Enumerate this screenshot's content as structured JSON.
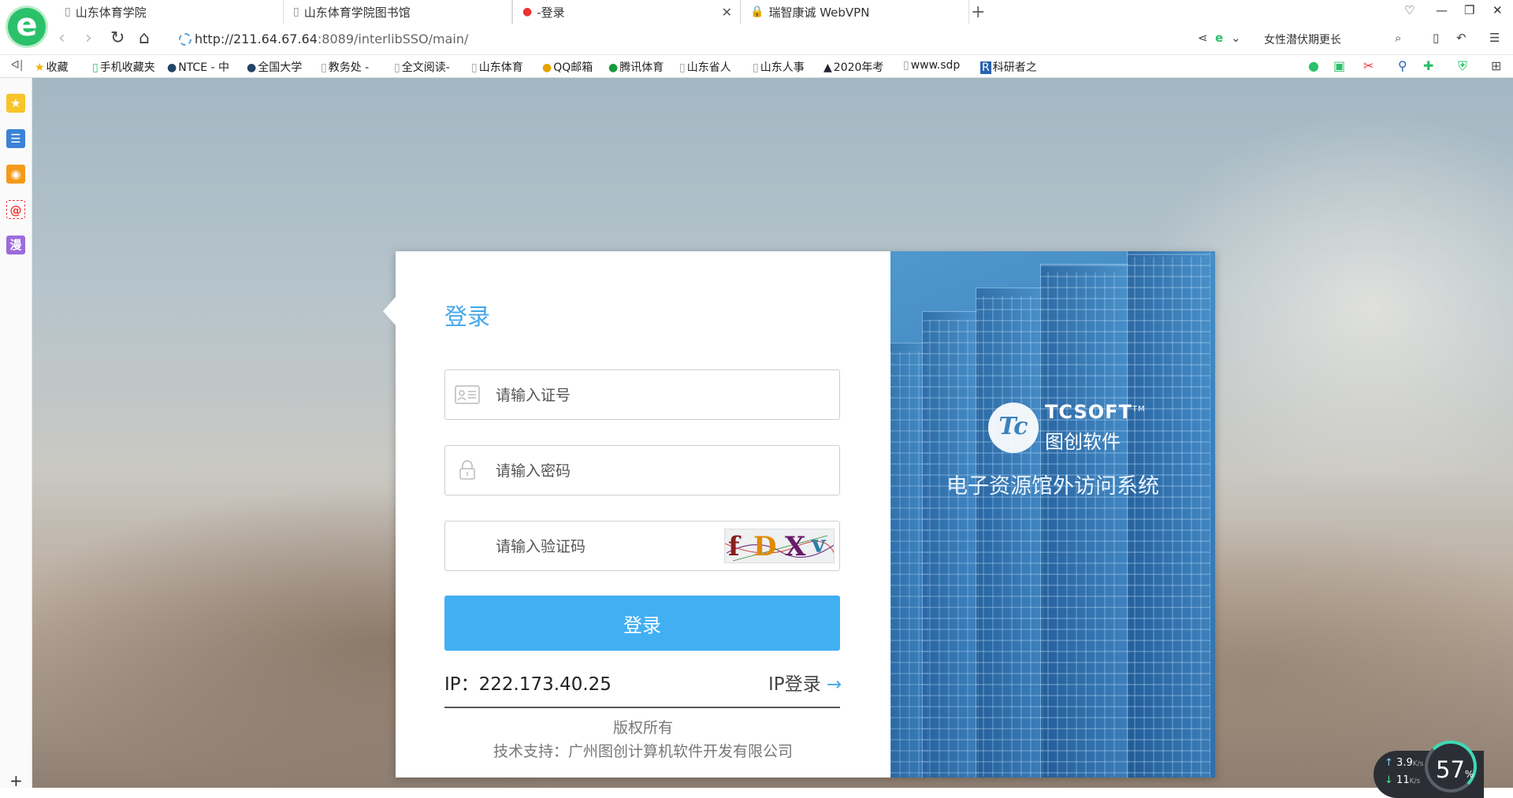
{
  "tabs": [
    {
      "label": "山东体育学院",
      "active": false
    },
    {
      "label": "山东体育学院图书馆",
      "active": false
    },
    {
      "label": "-登录",
      "active": true
    },
    {
      "label": "瑞智康诚 WebVPN",
      "active": false
    }
  ],
  "address": {
    "url_host": "http://211.64.67.64",
    "url_rest": ":8089/interlibSSO/main/"
  },
  "search": {
    "text": "女性潜伏期更长"
  },
  "bookmarks": [
    "收藏",
    "手机收藏夹",
    "NTCE - 中",
    "全国大学",
    "教务处 -",
    "全文阅读-",
    "山东体育",
    "QQ邮箱",
    "腾讯体育",
    "山东省人",
    "山东人事",
    "2020年考",
    "www.sdp",
    "科研者之"
  ],
  "sidebar": {
    "icons": [
      "star-icon",
      "list-icon",
      "weibo-icon",
      "mail-icon",
      "comic-icon"
    ],
    "comic_label": "漫"
  },
  "login": {
    "title": "登录",
    "id_placeholder": "请输入证号",
    "password_placeholder": "请输入密码",
    "captcha_placeholder": "请输入验证码",
    "captcha_text": [
      "f",
      "D",
      "X",
      "v"
    ],
    "button": "登录",
    "ip_label": "IP：222.173.40.25",
    "ip_login": "IP登录",
    "ip_login_arrow": "→",
    "copyright": "版权所有",
    "support": "技术支持：广州图创计算机软件开发有限公司"
  },
  "brand": {
    "logo_letters": "Tc",
    "name_en": "TCSOFT",
    "tm": "TM",
    "name_cn": "图创软件",
    "system_name": "电子资源馆外访问系统"
  },
  "net_widget": {
    "up": "3.9",
    "down": "11",
    "unit": "K/s",
    "percent": "57",
    "percent_unit": "%"
  },
  "colors": {
    "accent": "#42aff3",
    "title": "#43a7ea",
    "panel": "#3c82be"
  }
}
